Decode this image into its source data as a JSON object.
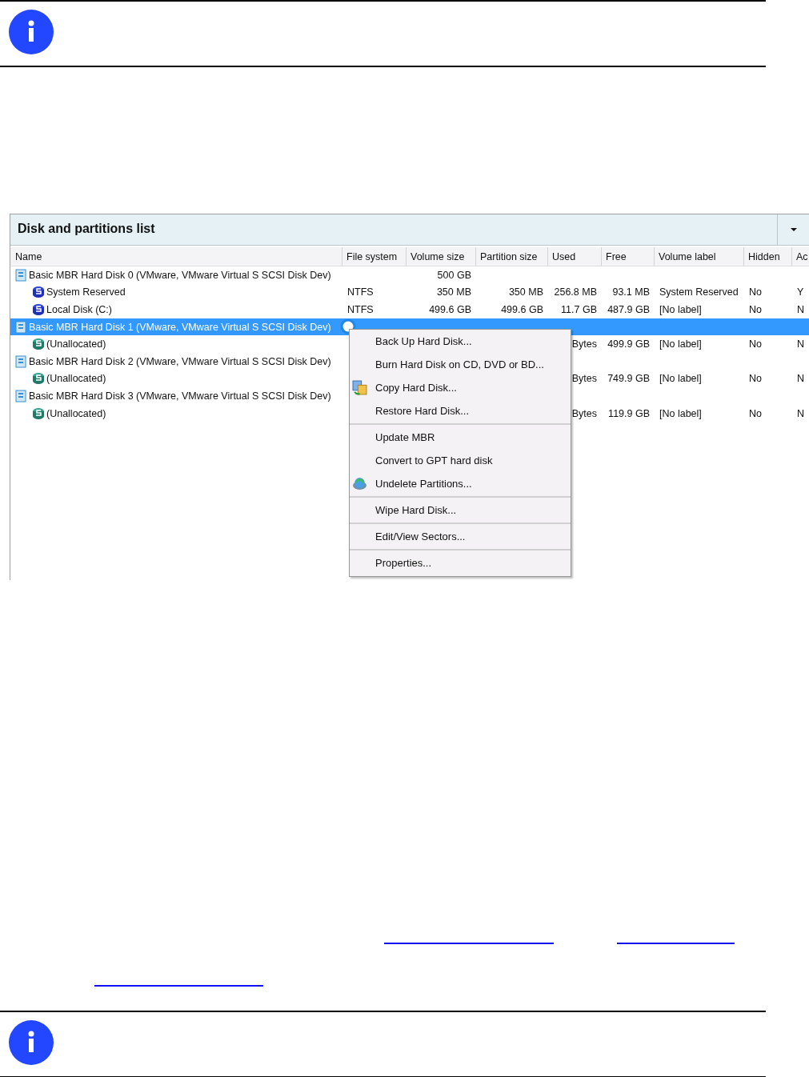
{
  "notes": [
    {
      "kind": "info"
    },
    {
      "kind": "info"
    }
  ],
  "panel": {
    "title": "Disk and partitions list",
    "columns": [
      "Name",
      "File system",
      "Volume size",
      "Partition size",
      "Used",
      "Free",
      "Volume label",
      "Hidden",
      "Ac"
    ],
    "rows": [
      {
        "name": "Basic MBR Hard Disk 0 (VMware, VMware Virtual S SCSI Disk Dev)",
        "kind": "disk",
        "selected": false,
        "volume_size": "500 GB",
        "children": [
          {
            "name": "System Reserved",
            "kind": "partition",
            "selected": false,
            "file_system": "NTFS",
            "volume_size": "350 MB",
            "partition_size": "350 MB",
            "used": "256.8 MB",
            "free": "93.1 MB",
            "volume_label": "System Reserved",
            "hidden": "No",
            "column_9": "Y"
          },
          {
            "name": "Local Disk (C:)",
            "kind": "partition",
            "selected": false,
            "file_system": "NTFS",
            "volume_size": "499.6 GB",
            "partition_size": "499.6 GB",
            "used": "11.7 GB",
            "free": "487.9 GB",
            "volume_label": "[No label]",
            "hidden": "No",
            "column_9": "N"
          }
        ]
      },
      {
        "name": "Basic MBR Hard Disk 1 (VMware, VMware Virtual S SCSI Disk Dev)",
        "kind": "disk",
        "selected": true,
        "children": [
          {
            "name": "(Unallocated)",
            "kind": "unallocated",
            "selected": false,
            "used": "Bytes",
            "free": "499.9 GB",
            "volume_label": "[No label]",
            "hidden": "No",
            "column_9": "N"
          }
        ]
      },
      {
        "name": "Basic MBR Hard Disk 2 (VMware, VMware Virtual S SCSI Disk Dev)",
        "kind": "disk",
        "selected": false,
        "children": [
          {
            "name": "(Unallocated)",
            "kind": "unallocated",
            "selected": false,
            "used": "Bytes",
            "free": "749.9 GB",
            "volume_label": "[No label]",
            "hidden": "No",
            "column_9": "N"
          }
        ]
      },
      {
        "name": "Basic MBR Hard Disk 3 (VMware, VMware Virtual S SCSI Disk Dev)",
        "kind": "disk",
        "selected": false,
        "children": [
          {
            "name": "(Unallocated)",
            "kind": "unallocated",
            "selected": false,
            "used": "Bytes",
            "free": "119.9 GB",
            "volume_label": "[No label]",
            "hidden": "No",
            "column_9": "N"
          }
        ]
      }
    ]
  },
  "context_menu": {
    "groups": [
      [
        {
          "label": "Back Up Hard Disk...",
          "kind": "plain"
        },
        {
          "label": "Burn Hard Disk on CD, DVD or BD...",
          "kind": "plain"
        },
        {
          "label": "Copy Hard Disk...",
          "kind": "copy"
        },
        {
          "label": "Restore Hard Disk...",
          "kind": "plain"
        }
      ],
      [
        {
          "label": "Update MBR",
          "kind": "plain"
        },
        {
          "label": "Convert to GPT hard disk",
          "kind": "plain"
        },
        {
          "label": "Undelete Partitions...",
          "kind": "undelete"
        }
      ],
      [
        {
          "label": "Wipe Hard Disk...",
          "kind": "plain"
        }
      ],
      [
        {
          "label": "Edit/View Sectors...",
          "kind": "plain"
        }
      ],
      [
        {
          "label": "Properties...",
          "kind": "plain"
        }
      ]
    ]
  }
}
